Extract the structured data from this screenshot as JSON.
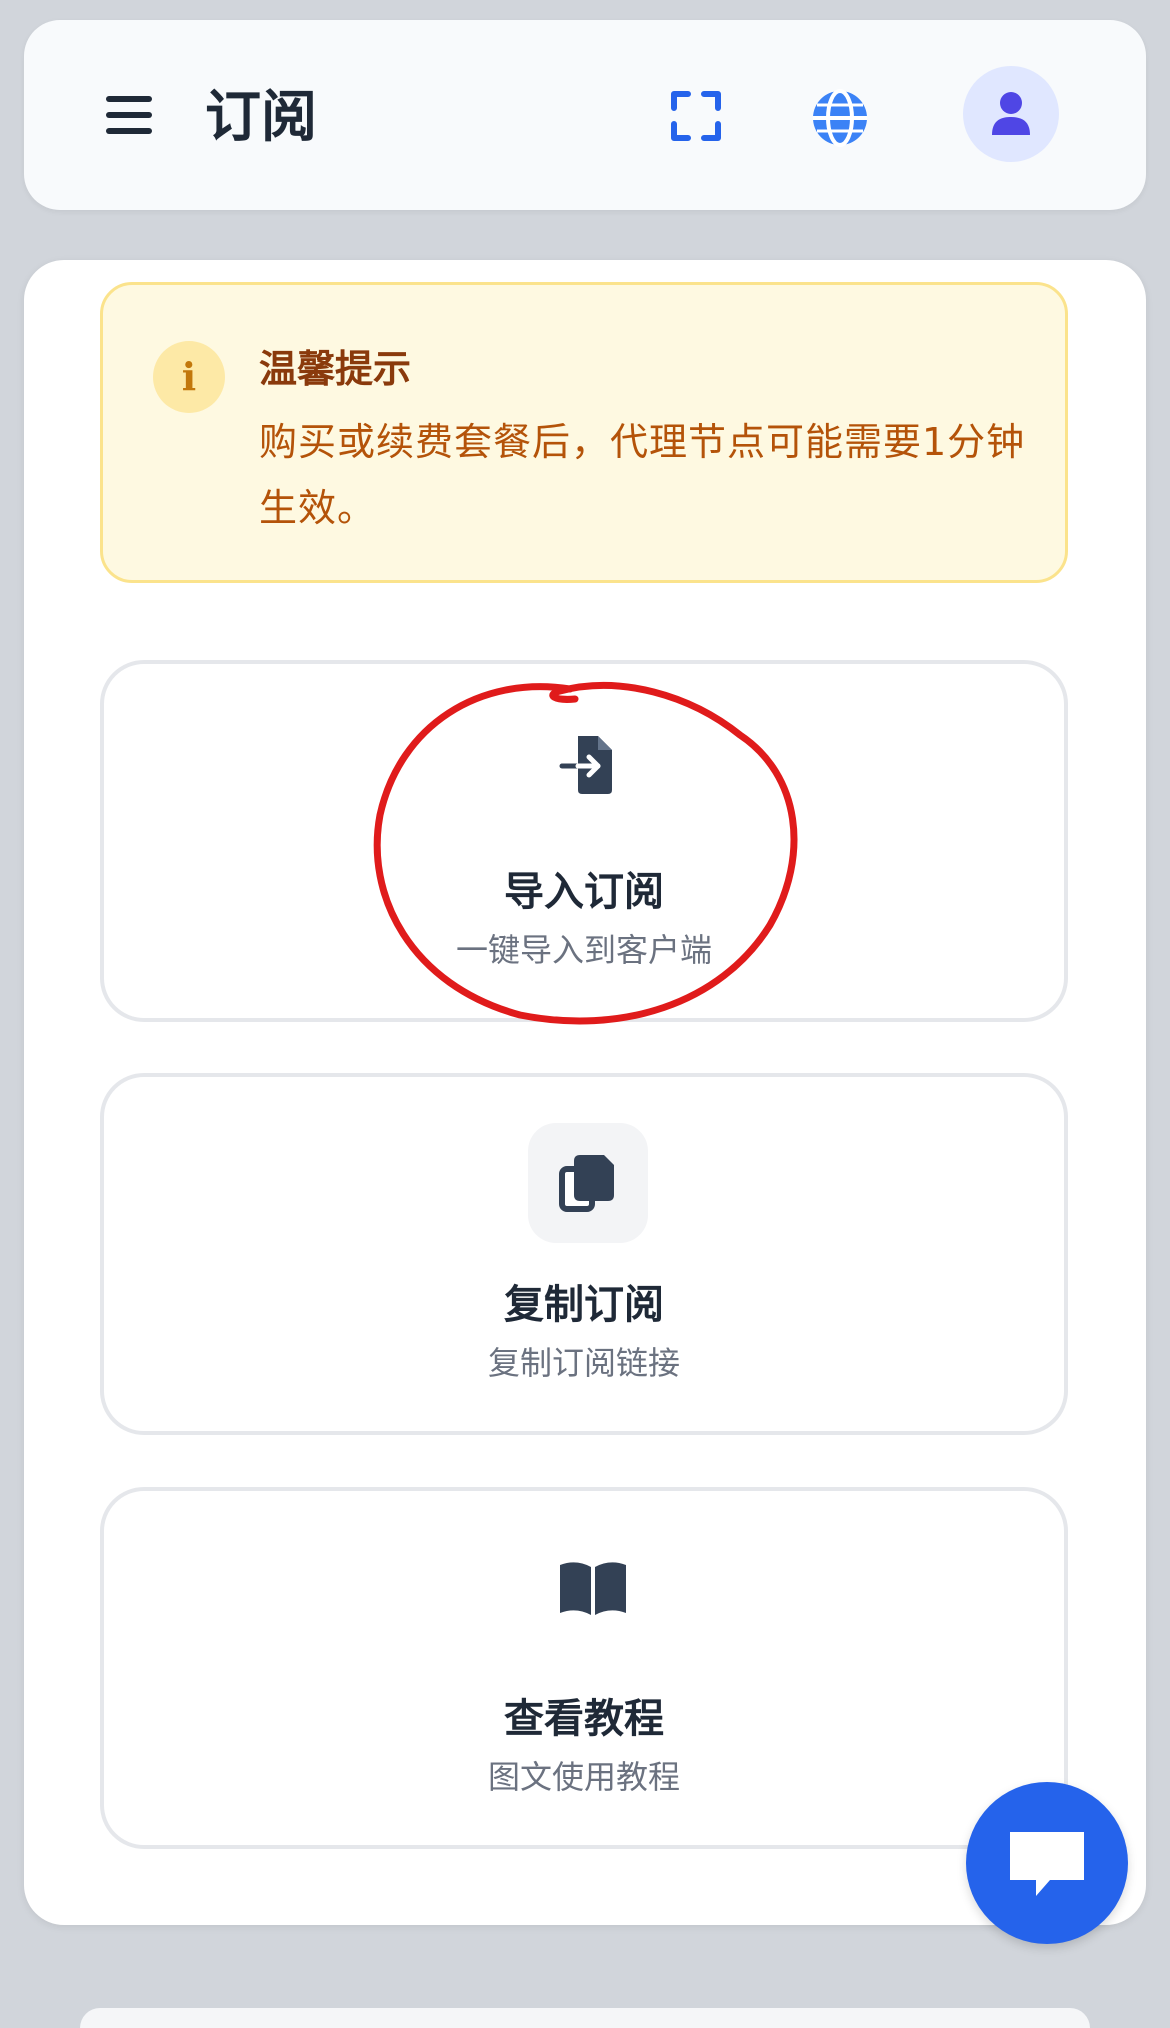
{
  "header": {
    "title": "订阅",
    "icons": [
      "menu-icon",
      "fullscreen-icon",
      "globe-icon",
      "user-icon"
    ]
  },
  "notice": {
    "title": "温馨提示",
    "text": "购买或续费套餐后，代理节点可能需要1分钟生效。",
    "icon_glyph": "i"
  },
  "actions": [
    {
      "title": "导入订阅",
      "subtitle": "一键导入到客户端",
      "icon": "file-import-icon"
    },
    {
      "title": "复制订阅",
      "subtitle": "复制订阅链接",
      "icon": "copy-icon"
    },
    {
      "title": "查看教程",
      "subtitle": "图文使用教程",
      "icon": "book-icon"
    }
  ],
  "chat": {
    "icon": "chat-icon"
  },
  "colors": {
    "accent": "#2563eb",
    "notice_bg": "#fef9e1",
    "notice_border": "#fbe38c",
    "notice_text": "#b45309",
    "annotation": "#e01b1b"
  }
}
